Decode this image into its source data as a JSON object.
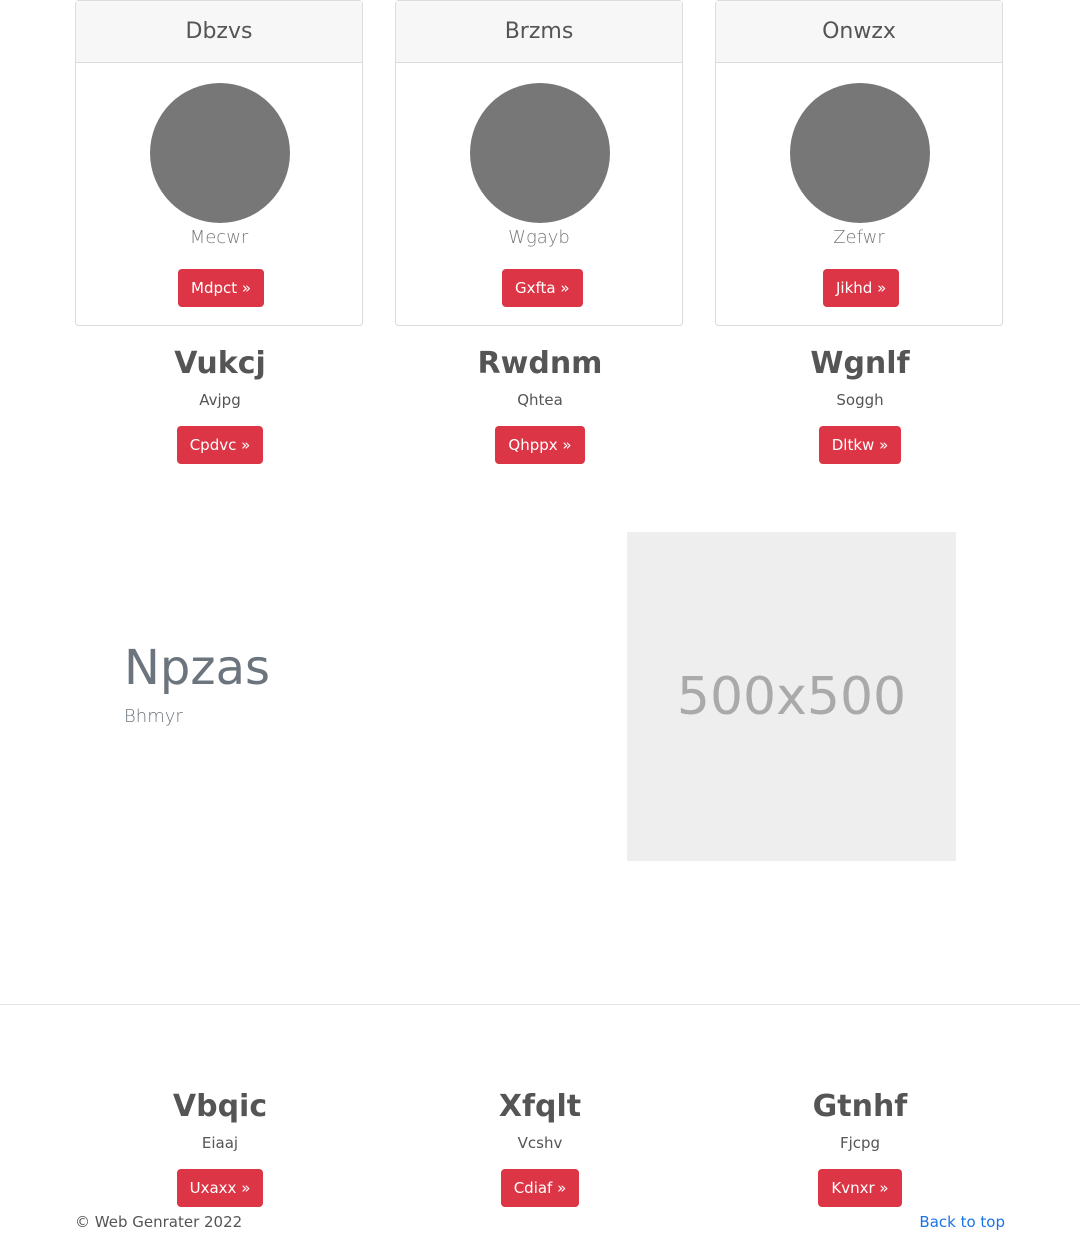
{
  "cards": [
    {
      "header": "Dbzvs",
      "name": "Mecwr",
      "button": "Mdpct »"
    },
    {
      "header": "Brzms",
      "name": "Wgayb",
      "button": "Gxfta »"
    },
    {
      "header": "Onwzx",
      "name": "Zefwr",
      "button": "Jikhd »"
    }
  ],
  "columns": [
    {
      "title": "Vukcj",
      "text": "Avjpg",
      "button": "Cpdvc »"
    },
    {
      "title": "Rwdnm",
      "text": "Qhtea",
      "button": "Qhppx »"
    },
    {
      "title": "Wgnlf",
      "text": "Soggh",
      "button": "Dltkw »"
    }
  ],
  "feature": {
    "title": "Npzas",
    "subtitle": "Bhmyr",
    "image_label": "500x500"
  },
  "bottom_columns": [
    {
      "title": "Vbqic",
      "text": "Eiaaj",
      "button": "Uxaxx »"
    },
    {
      "title": "Xfqlt",
      "text": "Vcshv",
      "button": "Cdiaf »"
    },
    {
      "title": "Gtnhf",
      "text": "Fjcpg",
      "button": "Kvnxr »"
    }
  ],
  "footer": {
    "copyright": "© Web Genrater 2022",
    "back_to_top": "Back to top"
  },
  "colors": {
    "button": "#dc3545",
    "avatar": "#777777",
    "link": "#1a73e8"
  }
}
